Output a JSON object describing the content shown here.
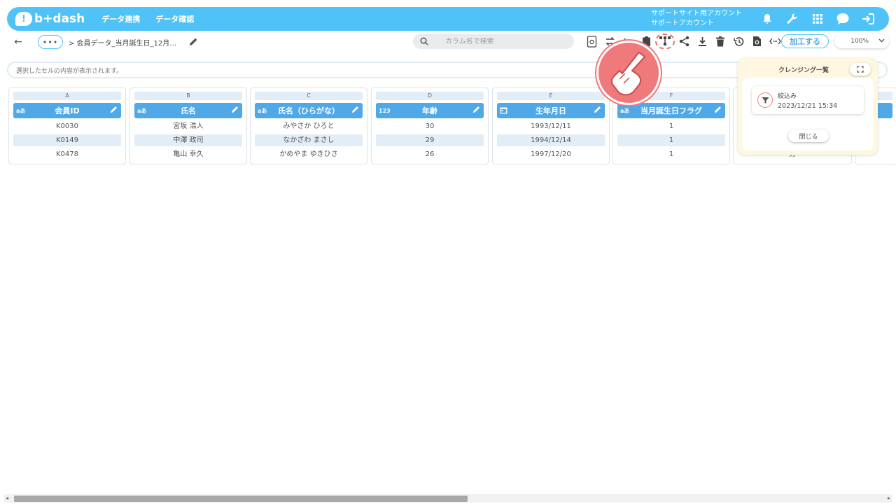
{
  "header": {
    "logo_text": "b+dash",
    "nav": [
      "データ連携",
      "データ確認"
    ],
    "account_line1": "サポートサイト用アカウント",
    "account_line2": "サポートアカウント",
    "brand_color": "#4fc3f7",
    "icons": [
      "bell-icon",
      "wrench-icon",
      "grid-icon",
      "chat-icon",
      "logout-icon"
    ]
  },
  "toolbar": {
    "back_label": "←",
    "more_label": "•••",
    "breadcrumb": "> 会員データ_当月誕生日_12月…",
    "search_placeholder": "カラム名で検索",
    "process_button": "加工する",
    "zoom": "100%"
  },
  "cellbar": {
    "text": "選択したセルの内容が表示されます。"
  },
  "columns": [
    {
      "letter": "A",
      "type": "aあ",
      "name": "会員ID",
      "cells": [
        "K0030",
        "K0149",
        "K0478"
      ]
    },
    {
      "letter": "B",
      "type": "aあ",
      "name": "氏名",
      "cells": [
        "宮坂 浩人",
        "中澤 政司",
        "亀山 幸久"
      ]
    },
    {
      "letter": "C",
      "type": "aあ",
      "name": "氏名（ひらがな）",
      "cells": [
        "みやさか ひろと",
        "なかざわ まさし",
        "かめやま ゆきひさ"
      ]
    },
    {
      "letter": "D",
      "type": "123",
      "name": "年齢",
      "cells": [
        "30",
        "29",
        "26"
      ]
    },
    {
      "letter": "E",
      "type": "calendar-icon",
      "name": "生年月日",
      "cells": [
        "1993/12/11",
        "1994/12/14",
        "1997/12/20"
      ]
    },
    {
      "letter": "F",
      "type": "aあ",
      "name": "当月誕生日フラグ",
      "cells": [
        "1",
        "1",
        "1"
      ]
    },
    {
      "letter": "",
      "type": "",
      "name": "",
      "cells": [
        "",
        "",
        "男"
      ]
    }
  ],
  "cleansing_panel": {
    "title": "クレンジング一覧",
    "entry_name": "絞込み",
    "entry_date": "2023/12/21 15:34",
    "close_label": "閉じる"
  }
}
